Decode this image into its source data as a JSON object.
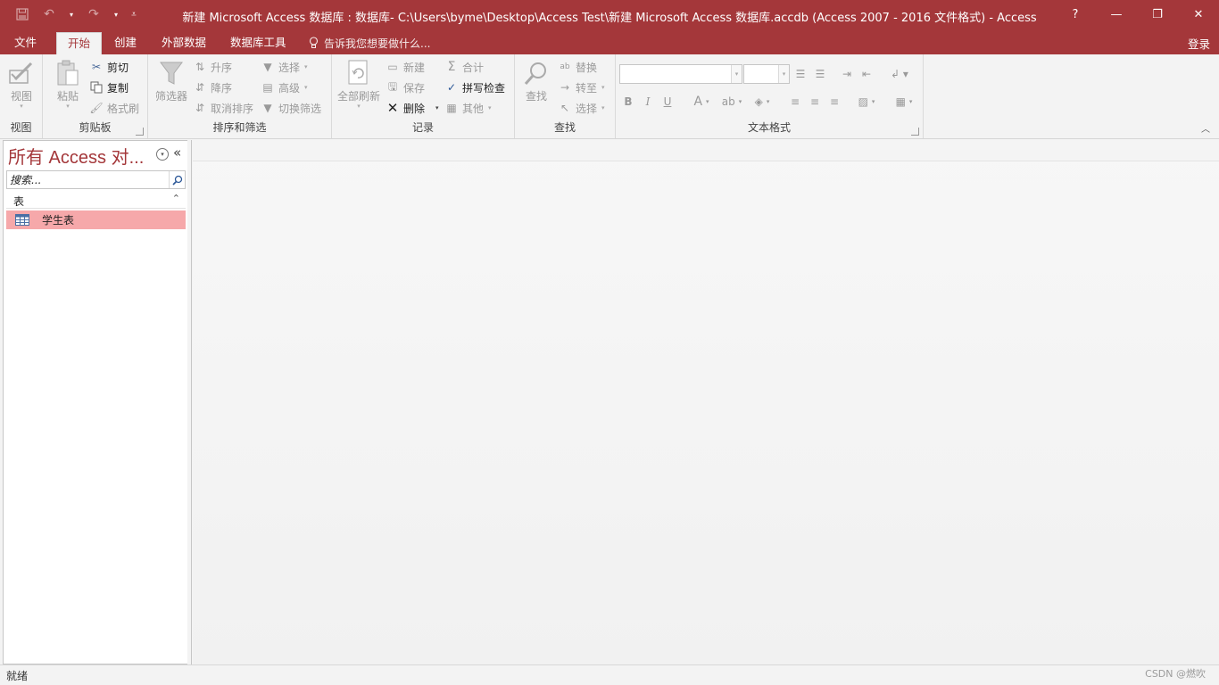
{
  "window": {
    "title": "新建 Microsoft Access 数据库 : 数据库- C:\\Users\\byme\\Desktop\\Access Test\\新建 Microsoft Access 数据库.accdb (Access 2007 - 2016 文件格式) - Access",
    "help": "?",
    "minimize": "—",
    "restore": "❐",
    "close": "✕"
  },
  "qat": {
    "save_icon": "save-icon",
    "undo_icon": "undo-icon",
    "redo_icon": "redo-icon",
    "customize_icon": "customize-icon"
  },
  "tabs": [
    {
      "label": "文件"
    },
    {
      "label": "开始",
      "active": true
    },
    {
      "label": "创建"
    },
    {
      "label": "外部数据"
    },
    {
      "label": "数据库工具"
    }
  ],
  "tellme": {
    "text": "告诉我您想要做什么..."
  },
  "signin": "登录",
  "ribbon": {
    "views": {
      "view_label": "视图",
      "group_label": "视图"
    },
    "clipboard": {
      "paste_label": "粘贴",
      "cut_label": "剪切",
      "copy_label": "复制",
      "format_painter_label": "格式刷",
      "group_label": "剪贴板"
    },
    "sort_filter": {
      "filter_label": "筛选器",
      "ascending_label": "升序",
      "descending_label": "降序",
      "remove_sort_label": "取消排序",
      "selection_label": "选择",
      "advanced_label": "高级",
      "toggle_filter_label": "切换筛选",
      "group_label": "排序和筛选"
    },
    "records": {
      "refresh_all_label": "全部刷新",
      "new_label": "新建",
      "save_label": "保存",
      "delete_label": "删除",
      "totals_label": "合计",
      "spelling_label": "拼写检查",
      "more_label": "其他",
      "group_label": "记录"
    },
    "find": {
      "find_label": "查找",
      "replace_label": "替换",
      "goto_label": "转至",
      "select_label": "选择",
      "group_label": "查找"
    },
    "text_formatting": {
      "font_name": "",
      "font_size": "",
      "bold": "B",
      "italic": "I",
      "underline": "U",
      "group_label": "文本格式"
    }
  },
  "nav": {
    "title": "所有 Access 对...",
    "search_placeholder": "搜索...",
    "group_label": "表",
    "items": [
      {
        "label": "学生表",
        "icon": "table-icon"
      }
    ]
  },
  "status": {
    "text": "就绪",
    "watermark": "CSDN @燃吹"
  },
  "colors": {
    "accent": "#a4373a",
    "selected_item": "#f6a8aa",
    "ribbon_bg": "#f3f3f3"
  }
}
